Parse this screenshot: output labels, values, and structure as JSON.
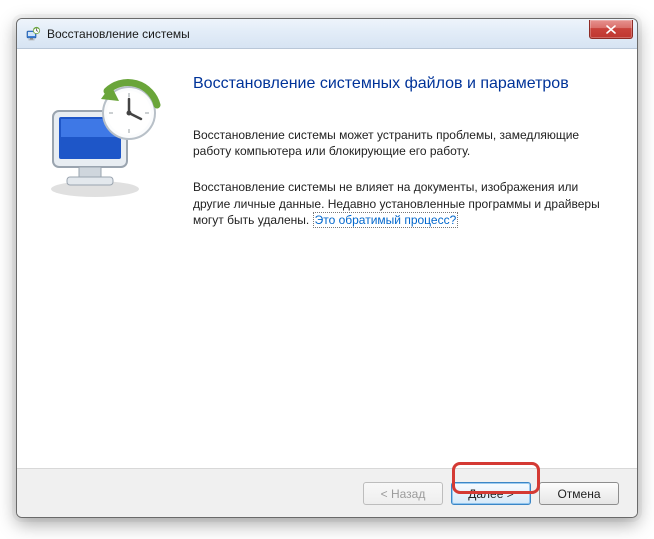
{
  "window": {
    "title": "Восстановление системы"
  },
  "content": {
    "heading": "Восстановление системных файлов и параметров",
    "para1": "Восстановление системы может устранить проблемы, замедляющие работу компьютера или блокирующие его работу.",
    "para2_pre": "Восстановление системы не влияет на документы, изображения или другие личные данные. Недавно установленные программы и драйверы могут быть удалены. ",
    "para2_link": "Это обратимый процесс?"
  },
  "buttons": {
    "back": "< Назад",
    "next": "Далее >",
    "cancel": "Отмена"
  }
}
